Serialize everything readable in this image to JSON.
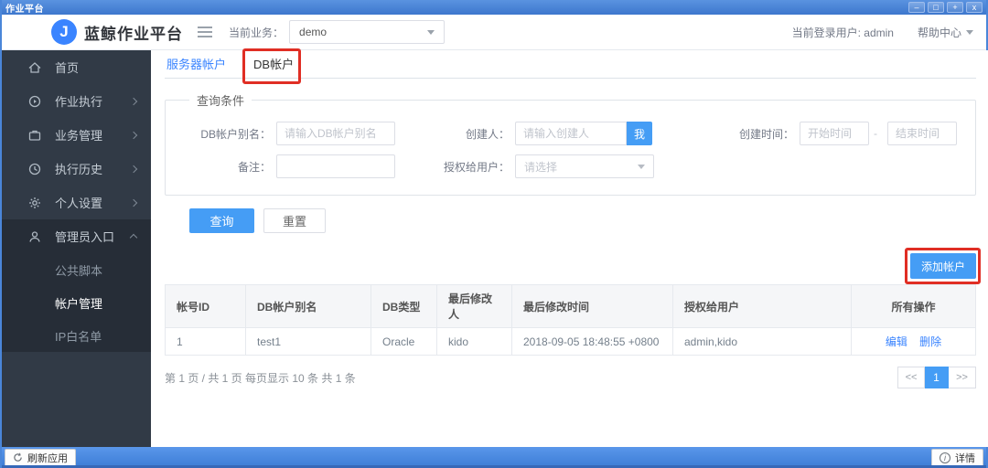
{
  "window": {
    "title": "作业平台",
    "controls": {
      "minimize": "–",
      "restore": "□",
      "maximize": "+",
      "close": "x"
    }
  },
  "header": {
    "logo_letter": "J",
    "brand": "蓝鲸作业平台",
    "business_label": "当前业务：",
    "business_value": "demo",
    "user_label": "当前登录用户: admin",
    "help_label": "帮助中心"
  },
  "sidebar": {
    "items": [
      {
        "label": "首页"
      },
      {
        "label": "作业执行"
      },
      {
        "label": "业务管理"
      },
      {
        "label": "执行历史"
      },
      {
        "label": "个人设置"
      },
      {
        "label": "管理员入口"
      }
    ],
    "submenu": [
      {
        "label": "公共脚本"
      },
      {
        "label": "帐户管理"
      },
      {
        "label": "IP白名单"
      }
    ]
  },
  "tabs": [
    {
      "label": "服务器帐户"
    },
    {
      "label": "DB帐户"
    }
  ],
  "query": {
    "panel_title": "查询条件",
    "db_alias_label": "DB帐户别名：",
    "db_alias_placeholder": "请输入DB帐户别名",
    "creator_label": "创建人：",
    "creator_placeholder": "请输入创建人",
    "me_button": "我",
    "create_time_label": "创建时间：",
    "start_placeholder": "开始时间",
    "time_separator": "-",
    "end_placeholder": "结束时间",
    "remark_label": "备注：",
    "grant_label": "授权给用户：",
    "grant_placeholder": "请选择",
    "search_button": "查询",
    "reset_button": "重置"
  },
  "add_button": "添加帐户",
  "table": {
    "columns": [
      "帐号ID",
      "DB帐户别名",
      "DB类型",
      "最后修改人",
      "最后修改时间",
      "授权给用户",
      "所有操作"
    ],
    "rows": [
      {
        "id": "1",
        "alias": "test1",
        "db_type": "Oracle",
        "modifier": "kido",
        "modified_time": "2018-09-05 18:48:55 +0800",
        "granted_users": "admin,kido",
        "actions": {
          "edit": "编辑",
          "delete": "删除"
        }
      }
    ]
  },
  "pagination": {
    "summary": "第 1 页 / 共 1 页  每页显示 10 条  共 1 条",
    "prev": "<<",
    "page": "1",
    "next": ">>"
  },
  "footer": {
    "refresh_label": "刷新应用",
    "detail_label": "详情"
  },
  "colors": {
    "accent": "#3a84ff",
    "button_blue": "#459df5",
    "annotation_red": "#e02e24",
    "titlebar_blue": "#4a86d9",
    "sidebar_bg": "#313a46",
    "sidebar_expanded_bg": "#262d37",
    "link_blue": "#3a84ff"
  }
}
